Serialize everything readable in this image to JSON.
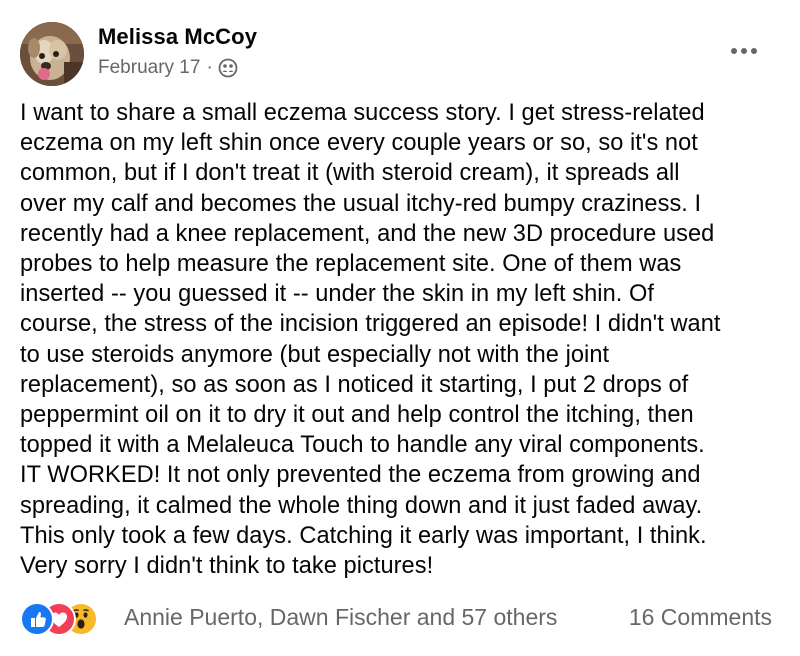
{
  "post": {
    "author": "Melissa McCoy",
    "date": "February 17",
    "separator": "·",
    "audience_icon": "friends-icon",
    "more_icon": "more-horizontal-icon",
    "body": "I want to share a small eczema success story. I get stress-related\neczema on my left shin once every couple years or so, so it's not\ncommon, but if I don't treat it (with steroid cream), it spreads all\nover my calf and becomes the usual itchy-red bumpy craziness. I\nrecently had a knee replacement, and the new 3D procedure used\nprobes to help measure the replacement site. One of them was\ninserted -- you guessed it -- under the skin in my left shin. Of\ncourse, the stress of the incision triggered an episode! I didn't want\nto use steroids anymore (but especially not with the joint\nreplacement), so as soon as I noticed it starting, I put 2 drops of\npeppermint oil on it to dry it out and help control the itching, then\ntopped it with a Melaleuca Touch to handle any viral components.\nIT WORKED! It not only prevented the eczema from growing and\nspreading, it calmed the whole thing down and it just faded away.\nThis only took a few days. Catching it early was important, I think.\nVery sorry I didn't think to take pictures!"
  },
  "footer": {
    "reaction_icons": [
      "like-icon",
      "love-icon",
      "wow-icon"
    ],
    "reactions_text": "Annie Puerto, Dawn Fischer and 57 others",
    "comments_text": "16 Comments"
  },
  "colors": {
    "text_primary": "#050505",
    "text_secondary": "#65676b",
    "like_blue": "#1877f2",
    "love_red": "#f33e58",
    "wow_yellow": "#f7b928"
  }
}
